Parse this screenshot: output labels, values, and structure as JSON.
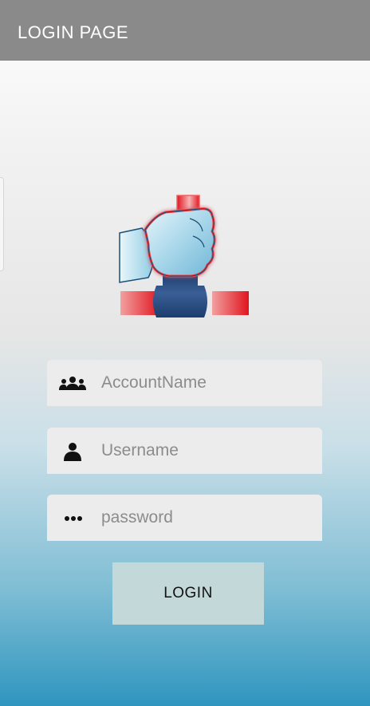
{
  "appbar": {
    "title": "LOGIN PAGE"
  },
  "form": {
    "account": {
      "placeholder": "AccountName",
      "value": ""
    },
    "username": {
      "placeholder": "Username",
      "value": ""
    },
    "password": {
      "placeholder": "password",
      "value": ""
    },
    "login_label": "LOGIN"
  },
  "icons": {
    "logo": "hand-on-pipe-logo",
    "account": "group-icon",
    "username": "person-icon",
    "password": "password-dots-icon"
  },
  "colors": {
    "appbar": "#8a8a8a",
    "button": "#c3d9d9",
    "field": "#ececec",
    "gradient_bottom": "#2f95bf"
  }
}
